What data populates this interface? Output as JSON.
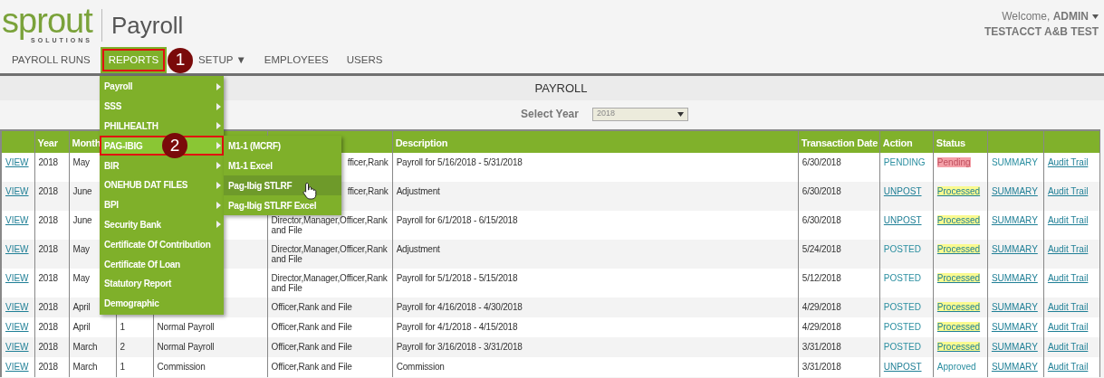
{
  "header": {
    "logo": {
      "word": "sprout",
      "tagline": "SOLUTIONS"
    },
    "app_title": "Payroll",
    "welcome": "Welcome, **ADMIN**",
    "company": "TESTACCT A&B TEST"
  },
  "nav": [
    {
      "label": "PAYROLL RUNS",
      "selected": false
    },
    {
      "label": "REPORTS",
      "selected": true,
      "badge": "1"
    },
    {
      "label": "SETUP ▼",
      "selected": false
    },
    {
      "label": "EMPLOYEES",
      "selected": false
    },
    {
      "label": "USERS",
      "selected": false
    }
  ],
  "reports_menu": [
    {
      "label": "Payroll",
      "submenu": true,
      "selected": false
    },
    {
      "label": "SSS",
      "submenu": true,
      "selected": false
    },
    {
      "label": "PHILHEALTH",
      "submenu": true,
      "selected": false
    },
    {
      "label": "PAG-IBIG",
      "submenu": true,
      "selected": true,
      "badge": "2",
      "children": [
        {
          "label": "M1-1 (MCRF)",
          "selected": false
        },
        {
          "label": "M1-1 Excel",
          "selected": false
        },
        {
          "label": "Pag-Ibig STLRF",
          "selected": true
        },
        {
          "label": "Pag-Ibig STLRF Excel",
          "selected": false
        }
      ]
    },
    {
      "label": "BIR",
      "submenu": true,
      "selected": false
    },
    {
      "label": "ONEHUB DAT FILES",
      "submenu": true,
      "selected": false
    },
    {
      "label": "BPI",
      "submenu": true,
      "selected": false
    },
    {
      "label": "Security Bank",
      "submenu": true,
      "selected": false
    },
    {
      "label": "Certificate Of Contribution",
      "submenu": false,
      "selected": false
    },
    {
      "label": "Certificate Of Loan",
      "submenu": false,
      "selected": false
    },
    {
      "label": "Statutory Report",
      "submenu": false,
      "selected": false
    },
    {
      "label": "Demographic",
      "submenu": false,
      "selected": false
    }
  ],
  "page_title": "PAYROLL",
  "year_filter": {
    "label": "Select Year",
    "value": "2018"
  },
  "table": {
    "columns": [
      null,
      "Year",
      "Month",
      null,
      null,
      null,
      "Description",
      "Transaction Date",
      "Action",
      "Status",
      null,
      null
    ],
    "rows": [
      {
        "tall": true,
        "cells": [
          {
            "text": "VIEW",
            "kind": "link"
          },
          {
            "text": "2018",
            "kind": "text"
          },
          {
            "text": "May",
            "kind": "text"
          },
          null,
          null,
          {
            "text": "fficer,Rank",
            "kind": "clipped"
          },
          {
            "text": "Payroll for 5/16/2018 - 5/31/2018",
            "kind": "text"
          },
          {
            "text": "6/30/2018",
            "kind": "text"
          },
          {
            "text": "PENDING",
            "kind": "teal"
          },
          {
            "text": "Pending",
            "kind": "pending"
          },
          {
            "text": "SUMMARY",
            "kind": "teal"
          },
          {
            "text": "Audit Trail",
            "kind": "link"
          }
        ]
      },
      {
        "tall": true,
        "cells": [
          {
            "text": "VIEW",
            "kind": "link"
          },
          {
            "text": "2018",
            "kind": "text"
          },
          {
            "text": "June",
            "kind": "text"
          },
          null,
          null,
          {
            "text": "fficer,Rank",
            "kind": "clipped"
          },
          {
            "text": "Adjustment",
            "kind": "text"
          },
          {
            "text": "6/30/2018",
            "kind": "text"
          },
          {
            "text": "UNPOST",
            "kind": "link"
          },
          {
            "text": "Processed",
            "kind": "processed"
          },
          {
            "text": "SUMMARY",
            "kind": "link"
          },
          {
            "text": "Audit Trail",
            "kind": "link"
          }
        ]
      },
      {
        "tall": true,
        "cells": [
          {
            "text": "VIEW",
            "kind": "link"
          },
          {
            "text": "2018",
            "kind": "text"
          },
          {
            "text": "June",
            "kind": "text"
          },
          null,
          null,
          {
            "text": "Director,Manager,Officer,Rank and File",
            "kind": "text"
          },
          {
            "text": "Payroll for 6/1/2018 - 6/15/2018",
            "kind": "text"
          },
          {
            "text": "6/30/2018",
            "kind": "text"
          },
          {
            "text": "UNPOST",
            "kind": "link"
          },
          {
            "text": "Processed",
            "kind": "processed"
          },
          {
            "text": "SUMMARY",
            "kind": "link"
          },
          {
            "text": "Audit Trail",
            "kind": "link"
          }
        ]
      },
      {
        "tall": true,
        "cells": [
          {
            "text": "VIEW",
            "kind": "link"
          },
          {
            "text": "2018",
            "kind": "text"
          },
          {
            "text": "May",
            "kind": "text"
          },
          null,
          null,
          {
            "text": "Director,Manager,Officer,Rank and File",
            "kind": "text"
          },
          {
            "text": "Adjustment",
            "kind": "text"
          },
          {
            "text": "5/24/2018",
            "kind": "text"
          },
          {
            "text": "POSTED",
            "kind": "teal"
          },
          {
            "text": "Processed",
            "kind": "processed"
          },
          {
            "text": "SUMMARY",
            "kind": "link"
          },
          {
            "text": "Audit Trail",
            "kind": "link"
          }
        ]
      },
      {
        "tall": true,
        "cells": [
          {
            "text": "VIEW",
            "kind": "link"
          },
          {
            "text": "2018",
            "kind": "text"
          },
          {
            "text": "May",
            "kind": "text"
          },
          null,
          null,
          {
            "text": "Director,Manager,Officer,Rank and File",
            "kind": "text"
          },
          {
            "text": "Payroll for 5/1/2018 - 5/15/2018",
            "kind": "text"
          },
          {
            "text": "5/12/2018",
            "kind": "text"
          },
          {
            "text": "POSTED",
            "kind": "teal"
          },
          {
            "text": "Processed",
            "kind": "processed"
          },
          {
            "text": "SUMMARY",
            "kind": "link"
          },
          {
            "text": "Audit Trail",
            "kind": "link"
          }
        ]
      },
      {
        "tall": false,
        "cells": [
          {
            "text": "VIEW",
            "kind": "link"
          },
          {
            "text": "2018",
            "kind": "text"
          },
          {
            "text": "April",
            "kind": "text"
          },
          null,
          null,
          {
            "text": "Officer,Rank and File",
            "kind": "text"
          },
          {
            "text": "Payroll for 4/16/2018 - 4/30/2018",
            "kind": "text"
          },
          {
            "text": "4/29/2018",
            "kind": "text"
          },
          {
            "text": "POSTED",
            "kind": "teal"
          },
          {
            "text": "Processed",
            "kind": "processed"
          },
          {
            "text": "SUMMARY",
            "kind": "link"
          },
          {
            "text": "Audit Trail",
            "kind": "link"
          }
        ]
      },
      {
        "tall": false,
        "cells": [
          {
            "text": "VIEW",
            "kind": "link"
          },
          {
            "text": "2018",
            "kind": "text"
          },
          {
            "text": "April",
            "kind": "text"
          },
          {
            "text": "1",
            "kind": "text"
          },
          {
            "text": "Normal Payroll",
            "kind": "text"
          },
          {
            "text": "Officer,Rank and File",
            "kind": "text"
          },
          {
            "text": "Payroll for 4/1/2018 - 4/15/2018",
            "kind": "text"
          },
          {
            "text": "4/29/2018",
            "kind": "text"
          },
          {
            "text": "POSTED",
            "kind": "teal"
          },
          {
            "text": "Processed",
            "kind": "processed"
          },
          {
            "text": "SUMMARY",
            "kind": "link"
          },
          {
            "text": "Audit Trail",
            "kind": "link"
          }
        ]
      },
      {
        "tall": false,
        "cells": [
          {
            "text": "VIEW",
            "kind": "link"
          },
          {
            "text": "2018",
            "kind": "text"
          },
          {
            "text": "March",
            "kind": "text"
          },
          {
            "text": "2",
            "kind": "text"
          },
          {
            "text": "Normal Payroll",
            "kind": "text"
          },
          {
            "text": "Officer,Rank and File",
            "kind": "text"
          },
          {
            "text": "Payroll for 3/16/2018 - 3/31/2018",
            "kind": "text"
          },
          {
            "text": "3/31/2018",
            "kind": "text"
          },
          {
            "text": "POSTED",
            "kind": "teal"
          },
          {
            "text": "Processed",
            "kind": "processed"
          },
          {
            "text": "SUMMARY",
            "kind": "link"
          },
          {
            "text": "Audit Trail",
            "kind": "link"
          }
        ]
      },
      {
        "tall": false,
        "cells": [
          {
            "text": "VIEW",
            "kind": "link"
          },
          {
            "text": "2018",
            "kind": "text"
          },
          {
            "text": "March",
            "kind": "text"
          },
          {
            "text": "1",
            "kind": "text"
          },
          {
            "text": "Commission",
            "kind": "text"
          },
          {
            "text": "Officer,Rank and File",
            "kind": "text"
          },
          {
            "text": "Commission",
            "kind": "text"
          },
          {
            "text": "3/31/2018",
            "kind": "text"
          },
          {
            "text": "UNPOST",
            "kind": "link"
          },
          {
            "text": "Approved",
            "kind": "teal"
          },
          {
            "text": "SUMMARY",
            "kind": "link"
          },
          {
            "text": "Audit Trail",
            "kind": "link"
          }
        ]
      }
    ]
  }
}
